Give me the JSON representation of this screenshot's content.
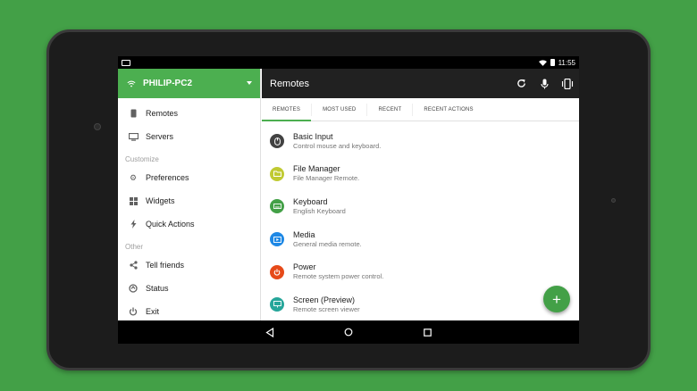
{
  "status_bar": {
    "time": "11:55"
  },
  "drawer": {
    "server_name": "PHILIP-PC2",
    "items": [
      {
        "label": "Remotes",
        "icon": "phone-icon"
      },
      {
        "label": "Servers",
        "icon": "monitor-icon"
      }
    ],
    "section_customize": "Customize",
    "customize_items": [
      {
        "label": "Preferences",
        "icon": "gear-icon"
      },
      {
        "label": "Widgets",
        "icon": "grid-icon"
      },
      {
        "label": "Quick Actions",
        "icon": "lightning-icon"
      }
    ],
    "section_other": "Other",
    "other_items": [
      {
        "label": "Tell friends",
        "icon": "share-icon"
      },
      {
        "label": "Status",
        "icon": "status-icon"
      },
      {
        "label": "Exit",
        "icon": "power-icon"
      }
    ]
  },
  "appbar": {
    "title": "Remotes"
  },
  "tabs": [
    "REMOTES",
    "MOST USED",
    "RECENT",
    "RECENT ACTIONS"
  ],
  "remotes": [
    {
      "name": "Basic Input",
      "desc": "Control mouse and keyboard.",
      "color": "#424242",
      "icon": "mouse-icon"
    },
    {
      "name": "File Manager",
      "desc": "File Manager Remote.",
      "color": "#c0ca33",
      "icon": "folder-icon"
    },
    {
      "name": "Keyboard",
      "desc": "English Keyboard",
      "color": "#43a047",
      "icon": "keyboard-icon"
    },
    {
      "name": "Media",
      "desc": "General media remote.",
      "color": "#1e88e5",
      "icon": "play-icon"
    },
    {
      "name": "Power",
      "desc": "Remote system power control.",
      "color": "#e64a19",
      "icon": "power-icon"
    },
    {
      "name": "Screen (Preview)",
      "desc": "Remote screen viewer",
      "color": "#26a69a",
      "icon": "screen-icon"
    }
  ],
  "fab": {
    "label": "+"
  },
  "colors": {
    "accent": "#4caf50",
    "appbar": "#212121",
    "background": "#43a047"
  }
}
